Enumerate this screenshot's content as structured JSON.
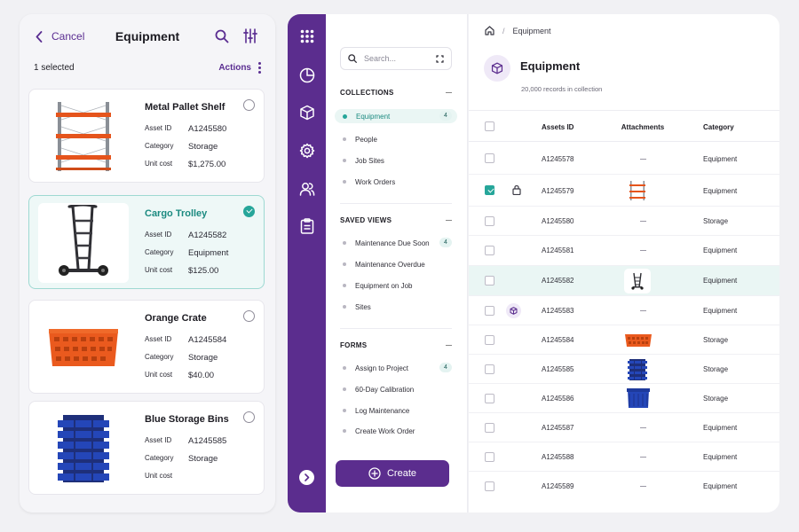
{
  "mobile": {
    "cancel_label": "Cancel",
    "title": "Equipment",
    "selected_text": "1 selected",
    "actions_label": "Actions",
    "cards": [
      {
        "name": "Metal Pallet Shelf",
        "asset_key": "Asset ID",
        "asset_id": "A1245580",
        "category_key": "Category",
        "category": "Storage",
        "cost_key": "Unit cost",
        "cost": "$1,275.00",
        "selected": false
      },
      {
        "name": "Cargo Trolley",
        "asset_key": "Asset ID",
        "asset_id": "A1245582",
        "category_key": "Category",
        "category": "Equipment",
        "cost_key": "Unit cost",
        "cost": "$125.00",
        "selected": true
      },
      {
        "name": "Orange Crate",
        "asset_key": "Asset ID",
        "asset_id": "A1245584",
        "category_key": "Category",
        "category": "Storage",
        "cost_key": "Unit cost",
        "cost": "$40.00",
        "selected": false
      },
      {
        "name": "Blue Storage Bins",
        "asset_key": "Asset ID",
        "asset_id": "A1245585",
        "category_key": "Category",
        "category": "Storage",
        "cost_key": "Unit cost",
        "cost": "",
        "selected": false
      }
    ]
  },
  "rail": {
    "icons": [
      "apps-grid-icon",
      "pie-chart-icon",
      "cube-icon",
      "settings-gear-icon",
      "users-icon",
      "clipboard-icon"
    ],
    "expand_icon": "chevron-right-icon"
  },
  "nav": {
    "search_placeholder": "Search...",
    "collections_title": "COLLECTIONS",
    "collections": [
      {
        "label": "Equipment",
        "count": "4",
        "active": true
      },
      {
        "label": "People",
        "count": ""
      },
      {
        "label": "Job Sites",
        "count": ""
      },
      {
        "label": "Work Orders",
        "count": ""
      }
    ],
    "saved_views_title": "SAVED VIEWS",
    "saved_views": [
      {
        "label": "Maintenance Due Soon",
        "count": "4"
      },
      {
        "label": "Maintenance Overdue",
        "count": ""
      },
      {
        "label": "Equipment on Job",
        "count": ""
      },
      {
        "label": "Sites",
        "count": ""
      }
    ],
    "forms_title": "FORMS",
    "forms": [
      {
        "label": "Assign to Project",
        "count": "4"
      },
      {
        "label": "60-Day Calibration",
        "count": ""
      },
      {
        "label": "Log Maintenance",
        "count": ""
      },
      {
        "label": "Create Work Order",
        "count": ""
      }
    ],
    "create_label": "Create"
  },
  "main": {
    "breadcrumb": "Equipment",
    "title": "Equipment",
    "subtitle": "20,000 records in collection",
    "columns": {
      "id": "Assets ID",
      "attachments": "Attachments",
      "category": "Category"
    },
    "rows": [
      {
        "id": "A1245578",
        "attachment": "none",
        "category": "Equipment"
      },
      {
        "id": "A1245579",
        "attachment": "shelf",
        "category": "Equipment",
        "checked": true,
        "locked": true
      },
      {
        "id": "A1245580",
        "attachment": "none",
        "category": "Storage"
      },
      {
        "id": "A1245581",
        "attachment": "none",
        "category": "Equipment"
      },
      {
        "id": "A1245582",
        "attachment": "trolley",
        "category": "Equipment",
        "highlighted": true
      },
      {
        "id": "A1245583",
        "attachment": "none",
        "category": "Equipment",
        "cube": true
      },
      {
        "id": "A1245584",
        "attachment": "crate",
        "category": "Storage"
      },
      {
        "id": "A1245585",
        "attachment": "bins",
        "category": "Storage"
      },
      {
        "id": "A1245586",
        "attachment": "bin",
        "category": "Storage"
      },
      {
        "id": "A1245587",
        "attachment": "none",
        "category": "Equipment"
      },
      {
        "id": "A1245588",
        "attachment": "none",
        "category": "Equipment"
      },
      {
        "id": "A1245589",
        "attachment": "none",
        "category": "Equipment"
      }
    ]
  },
  "colors": {
    "brand_purple": "#5b2d8e",
    "accent_teal": "#26a69a"
  }
}
